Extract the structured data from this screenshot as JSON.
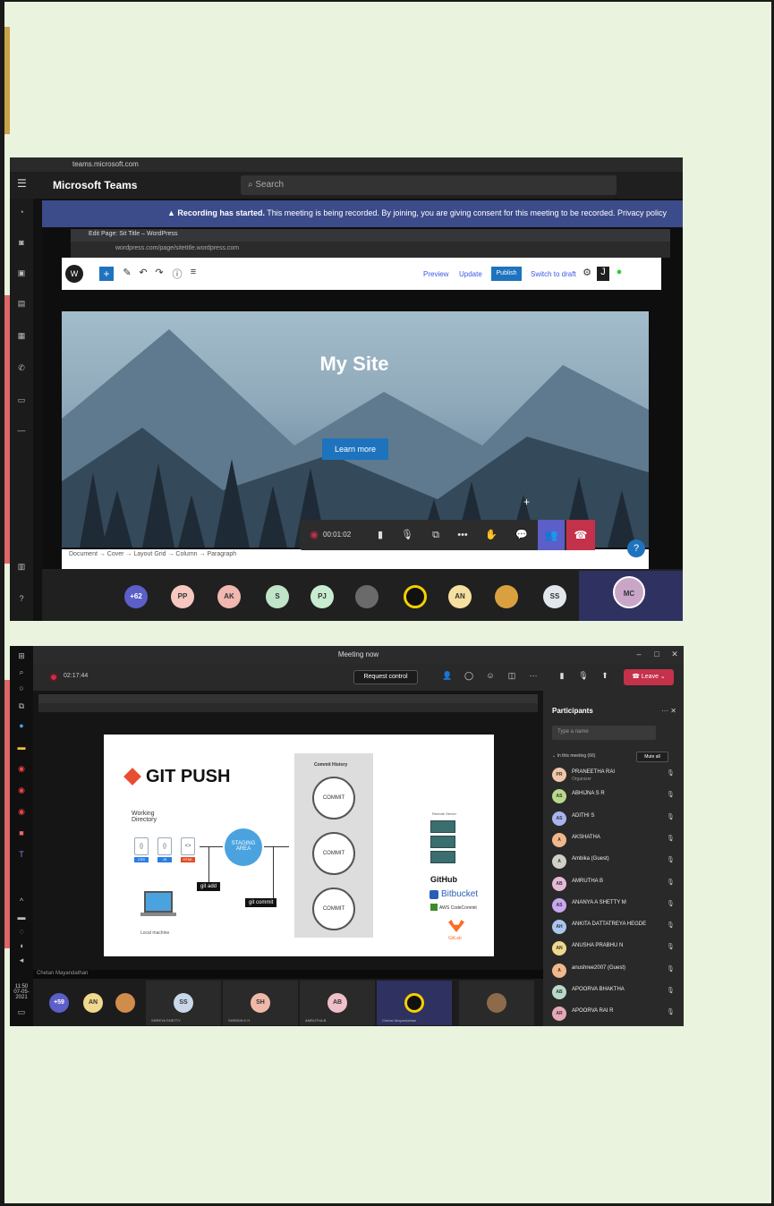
{
  "shot1": {
    "browser_url": "teams.microsoft.com",
    "app_title": "Microsoft Teams",
    "search_placeholder": "Search",
    "rail_items": [
      "Activity",
      "Chat",
      "Teams",
      "Assignments",
      "Calendar",
      "Calls",
      "Files"
    ],
    "recording_title": "Recording has started.",
    "recording_text": "This meeting is being recorded. By joining, you are giving consent for this meeting to be recorded. Privacy policy",
    "inner_tab": "Edit Page: Sit Title – WordPress",
    "inner_address": "wordpress.com/page/sitetitle.wordpress.com",
    "wp_links": {
      "preview": "Preview",
      "update": "Update",
      "publish": "Publish",
      "switch": "Switch to draft"
    },
    "hero_title": "My Site",
    "hero_button": "Learn more",
    "breadcrumb": "Document → Cover → Layout Grid → Column → Paragraph",
    "call_timer": "00:01:02",
    "gallery_count": "+62",
    "gallery": [
      "PP",
      "AK",
      "S",
      "PJ",
      "",
      "",
      "AN",
      "",
      "SS"
    ],
    "self_initials": "MC"
  },
  "shot2": {
    "window_title": "Meeting now",
    "timer": "02:17:44",
    "request_control": "Request control",
    "leave": "Leave",
    "slide": {
      "title": "GIT PUSH",
      "working_dir": "Working Directory",
      "files": [
        {
          "icon": "{}",
          "label": "CSS"
        },
        {
          "icon": "{}",
          "label": "JS"
        },
        {
          "icon": "<>",
          "label": "HTML"
        }
      ],
      "staging": "STAGING AREA",
      "git_add": "git add",
      "git_commit": "git commit",
      "local_machine": "Local machine",
      "commit_history": "Commit History",
      "commit": "COMMIT",
      "remote_server": "Remote Server",
      "github": "GitHub",
      "bitbucket": "Bitbucket",
      "aws": "AWS CodeCommit",
      "gitlab": "GitLab"
    },
    "shared_by": "Chetan Mayandathan",
    "participants_title": "Participants",
    "type_name_placeholder": "Type a name",
    "in_meeting": "In this meeting (66)",
    "mute_all": "Mute all",
    "participants": [
      {
        "initials": "PR",
        "name": "PRANEETHA RAI",
        "role": "Organizer",
        "color": "#f0c6a8"
      },
      {
        "initials": "AS",
        "name": "ABHIJNA S R",
        "role": "",
        "color": "#b8d88c"
      },
      {
        "initials": "AS",
        "name": "ADITHI S",
        "role": "",
        "color": "#a8b4ef"
      },
      {
        "initials": "A",
        "name": "AKSHATHA",
        "role": "",
        "color": "#f0b88c"
      },
      {
        "initials": "A",
        "name": "Ambika (Guest)",
        "role": "",
        "color": "#d0d0c8"
      },
      {
        "initials": "AB",
        "name": "AMRUTHA B",
        "role": "",
        "color": "#e7b9d8"
      },
      {
        "initials": "AS",
        "name": "ANANYA A SHETTY M",
        "role": "",
        "color": "#c8a8ef"
      },
      {
        "initials": "AH",
        "name": "ANKITA DATTATREYA HEGDE",
        "role": "",
        "color": "#a8c6ef"
      },
      {
        "initials": "AN",
        "name": "ANUSHA PRABHU N",
        "role": "",
        "color": "#f0d88c"
      },
      {
        "initials": "A",
        "name": "anushree2007 (Guest)",
        "role": "",
        "color": "#f0b88c"
      },
      {
        "initials": "AB",
        "name": "APOORVA BHAKTHA",
        "role": "",
        "color": "#b8d8c8"
      },
      {
        "initials": "AR",
        "name": "APOORVA RAI R",
        "role": "",
        "color": "#e7a8b8"
      }
    ],
    "gallery_count": "+59",
    "gallery": [
      {
        "initials": "AN",
        "name": "",
        "color": "#f0d88c"
      },
      {
        "initials": "",
        "name": "",
        "color": "#d08c4a"
      },
      {
        "initials": "SS",
        "name": "SHREYA SHETTY",
        "color": "#c8d8e8"
      },
      {
        "initials": "SH",
        "name": "SHRIDHI K H",
        "color": "#f0b8a8"
      },
      {
        "initials": "AB",
        "name": "AMRUTHA B",
        "color": "#f0c0c8"
      },
      {
        "initials": "",
        "name": "Chetan Mayandathan",
        "color": "#f5d000"
      },
      {
        "initials": "",
        "name": "",
        "color": "#8c6a4a"
      }
    ],
    "clock": "11:50",
    "date": "07-05-2021"
  }
}
